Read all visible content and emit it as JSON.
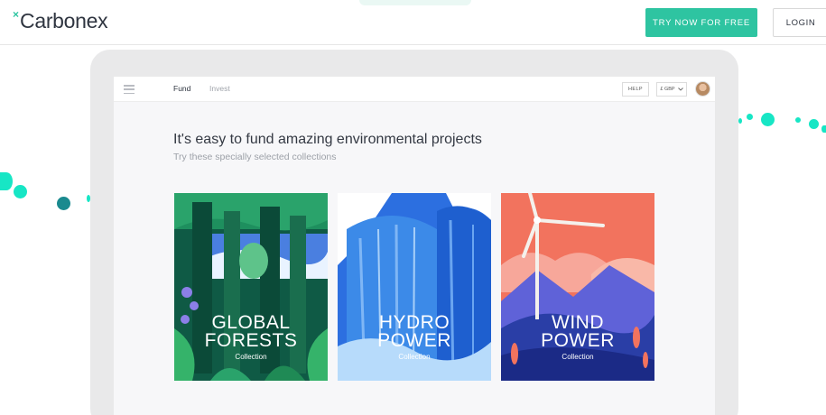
{
  "header": {
    "logo_mark": "×",
    "logo_text": "Carbonex",
    "try_button": "TRY NOW FOR FREE",
    "login_button": "LOGIN"
  },
  "app": {
    "nav": {
      "tab_fund": "Fund",
      "tab_invest": "Invest"
    },
    "help_button": "HELP",
    "currency": "£ GBP",
    "headline": "It's easy to fund amazing environmental projects",
    "subhead": "Try these specially selected collections",
    "cards": [
      {
        "line1": "GLOBAL",
        "line2": "FORESTS",
        "sub": "Collection"
      },
      {
        "line1": "HYDRO",
        "line2": "POWER",
        "sub": "Collection"
      },
      {
        "line1": "WIND",
        "line2": "POWER",
        "sub": "Collection"
      }
    ]
  },
  "colors": {
    "accent": "#2ec4a1",
    "dot_teal_dark": "#1a8a8f"
  }
}
